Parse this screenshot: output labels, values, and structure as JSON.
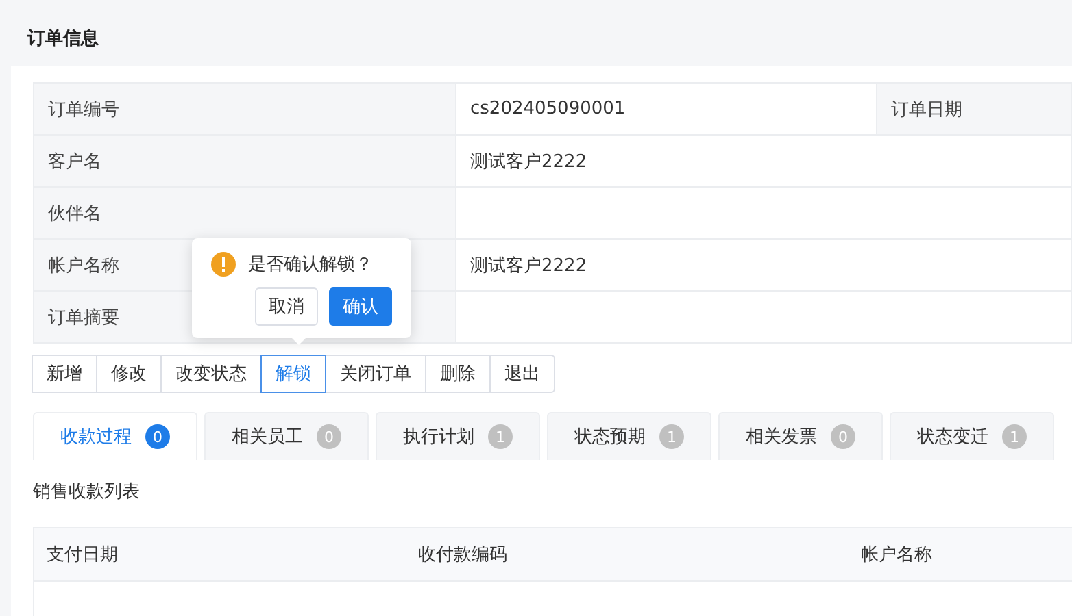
{
  "section_title": "订单信息",
  "order_info": {
    "rows": [
      {
        "label": "订单编号",
        "value": "cs202405090001",
        "extra_label": "订单日期"
      },
      {
        "label": "客户名",
        "value": "测试客户2222"
      },
      {
        "label": "伙伴名"
      },
      {
        "label": "帐户名称",
        "value": "测试客户2222"
      },
      {
        "label": "订单摘要"
      }
    ]
  },
  "actions": [
    {
      "label": "新增",
      "selected": false
    },
    {
      "label": "修改",
      "selected": false
    },
    {
      "label": "改变状态",
      "selected": false
    },
    {
      "label": "解锁",
      "selected": true
    },
    {
      "label": "关闭订单",
      "selected": false
    },
    {
      "label": "删除",
      "selected": false
    },
    {
      "label": "退出",
      "selected": false
    }
  ],
  "confirm_popover": {
    "message": "是否确认解锁？",
    "buttons": [
      {
        "label": "取消",
        "kind": "default"
      },
      {
        "label": "确认",
        "kind": "primary"
      }
    ]
  },
  "tabs": [
    {
      "label": "收款过程",
      "count": "0",
      "selected": true
    },
    {
      "label": "相关员工",
      "count": "0",
      "selected": false
    },
    {
      "label": "执行计划",
      "count": "1",
      "selected": false
    },
    {
      "label": "状态预期",
      "count": "1",
      "selected": false
    },
    {
      "label": "相关发票",
      "count": "0",
      "selected": false
    },
    {
      "label": "状态变迁",
      "count": "1",
      "selected": false
    }
  ],
  "list_title": "销售收款列表",
  "list_table": {
    "columns": [
      "支付日期",
      "收付款编码",
      "帐户名称"
    ]
  }
}
